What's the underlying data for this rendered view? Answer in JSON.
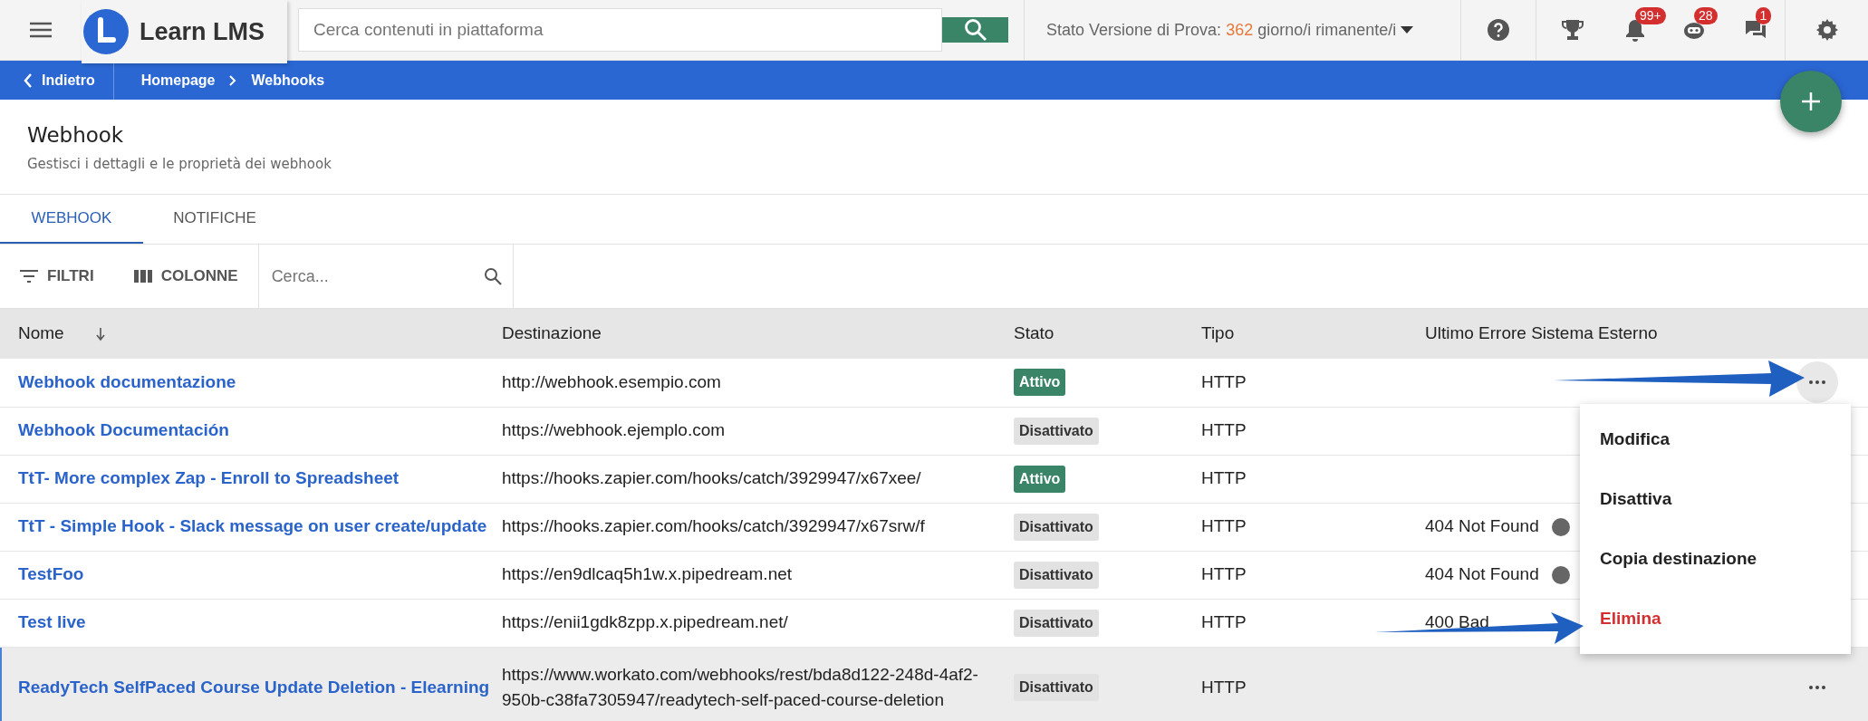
{
  "topbar": {
    "logo_text": "Learn LMS",
    "search": {
      "placeholder": "Cerca contenuti in piattaforma"
    },
    "trial": {
      "label": "Stato Versione di Prova:",
      "days": "362",
      "suffix": "giorno/i rimanente/i"
    },
    "icons": [
      {
        "kind": "help"
      },
      {
        "kind": "trophy"
      },
      {
        "kind": "bell",
        "badge": "99+"
      },
      {
        "kind": "robot",
        "badge": "28"
      },
      {
        "kind": "chat",
        "badge": "1"
      },
      {
        "kind": "settings"
      }
    ]
  },
  "breadcrumb": {
    "back": "Indietro",
    "items": [
      "Homepage",
      "Webhooks"
    ]
  },
  "page": {
    "title": "Webhook",
    "subtitle": "Gestisci i dettagli e le proprietà dei webhook"
  },
  "tabs": [
    {
      "label": "WEBHOOK",
      "selected": true
    },
    {
      "label": "NOTIFICHE",
      "selected": false
    }
  ],
  "toolbar": {
    "filters": "FILTRI",
    "columns": "COLONNE",
    "search": {
      "placeholder": "Cerca..."
    }
  },
  "table": {
    "columns": [
      {
        "label": "Nome",
        "sorted": true
      },
      {
        "label": "Destinazione",
        "sorted": false
      },
      {
        "label": "Stato",
        "sorted": false
      },
      {
        "label": "Tipo",
        "sorted": false
      },
      {
        "label": "Ultimo Errore Sistema Esterno",
        "sorted": false
      }
    ],
    "rows": [
      {
        "name": "Webhook documentazione",
        "destination": "http://webhook.esempio.com",
        "status": {
          "label": "Attivo",
          "kind": "active"
        },
        "type": "HTTP",
        "actions_visible": true,
        "actions_open": true,
        "highlighted": false
      },
      {
        "name": "Webhook Documentación",
        "destination": "https://webhook.ejemplo.com",
        "status": {
          "label": "Disattivato",
          "kind": "inactive"
        },
        "type": "HTTP",
        "highlighted": false
      },
      {
        "name": "TtT- More complex Zap - Enroll to Spreadsheet",
        "destination": "https://hooks.zapier.com/hooks/catch/3929947/x67xee/",
        "status": {
          "label": "Attivo",
          "kind": "active"
        },
        "type": "HTTP",
        "highlighted": false
      },
      {
        "name": "TtT - Simple Hook - Slack message on user create/update",
        "destination": "https://hooks.zapier.com/hooks/catch/3929947/x67srw/f",
        "status": {
          "label": "Disattivato",
          "kind": "inactive"
        },
        "type": "HTTP",
        "error": "404 Not Found",
        "error_icon": true,
        "highlighted": false
      },
      {
        "name": "TestFoo",
        "destination": "https://en9dlcaq5h1w.x.pipedream.net",
        "status": {
          "label": "Disattivato",
          "kind": "inactive"
        },
        "type": "HTTP",
        "error": "404 Not Found",
        "error_icon": true,
        "highlighted": false
      },
      {
        "name": "Test live",
        "destination": "https://enii1gdk8zpp.x.pipedream.net/",
        "status": {
          "label": "Disattivato",
          "kind": "inactive"
        },
        "type": "HTTP",
        "error": "400 Bad",
        "highlighted": false
      },
      {
        "name": "ReadyTech SelfPaced Course Update Deletion - Elearning",
        "destination": "https://www.workato.com/webhooks/rest/bda8d122-248d-4af2-950b-c38fa7305947/readytech-self-paced-course-deletion",
        "status": {
          "label": "Disattivato",
          "kind": "inactive"
        },
        "type": "HTTP",
        "actions_visible": true,
        "actions_open": false,
        "highlighted": true
      }
    ]
  },
  "context_menu": {
    "items": [
      {
        "label": "Modifica",
        "kind": "normal"
      },
      {
        "label": "Disattiva",
        "kind": "normal"
      },
      {
        "label": "Copia destinazione",
        "kind": "normal"
      },
      {
        "label": "Elimina",
        "kind": "danger"
      }
    ]
  }
}
